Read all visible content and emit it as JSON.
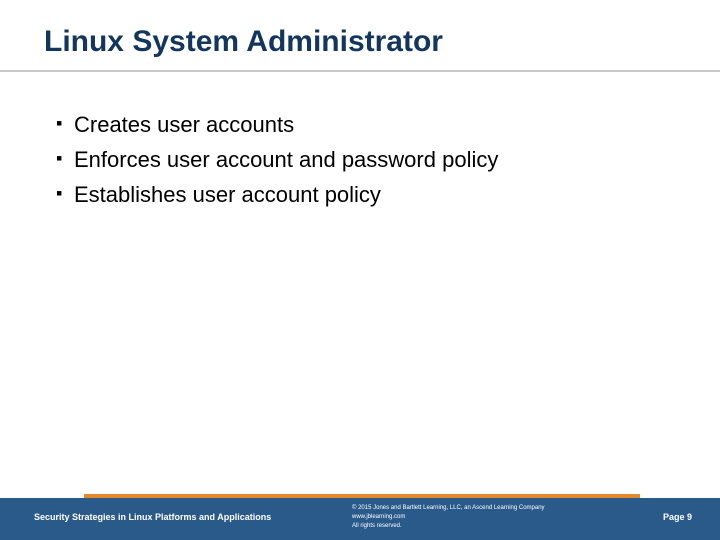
{
  "title": "Linux System Administrator",
  "bullets": [
    "Creates user accounts",
    "Enforces user account and password policy",
    "Establishes user account policy"
  ],
  "footer": {
    "left": "Security Strategies in Linux Platforms and Applications",
    "copyright_line1": "© 2015 Jones and Bartlett Learning, LLC, an Ascend Learning Company",
    "copyright_line2": "www.jblearning.com",
    "copyright_line3": "All rights reserved.",
    "page_label": "Page 9"
  }
}
